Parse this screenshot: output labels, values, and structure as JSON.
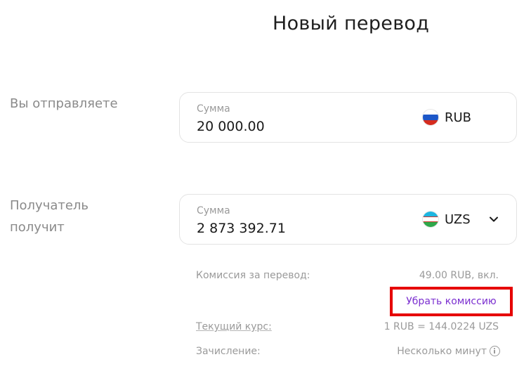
{
  "page": {
    "title": "Новый перевод"
  },
  "send": {
    "label": "Вы отправляете",
    "field_label": "Сумма",
    "amount": "20 000.00",
    "currency": "RUB",
    "flag_colors": [
      "#ffffff",
      "#1c57c8",
      "#d52b1e"
    ]
  },
  "receive": {
    "label_line1": "Получатель",
    "label_line2": "получит",
    "field_label": "Сумма",
    "amount": "2 873 392.71",
    "currency": "UZS",
    "flag_colors": [
      "#1eb5e0",
      "#ffffff",
      "#2fa84a"
    ]
  },
  "details": {
    "fee_label": "Комиссия за перевод:",
    "fee_value": "49.00 RUB, вкл.",
    "remove_fee": "Убрать комиссию",
    "rate_label": "Текущий курс:",
    "rate_value": "1 RUB = 144.0224 UZS",
    "credit_label": "Зачисление:",
    "credit_value": "Несколько минут"
  },
  "colors": {
    "accent_link": "#7b2fd0",
    "highlight_border": "#e60000"
  },
  "icons": {
    "dropdown": "chevron-down-icon",
    "info": "info-icon"
  }
}
